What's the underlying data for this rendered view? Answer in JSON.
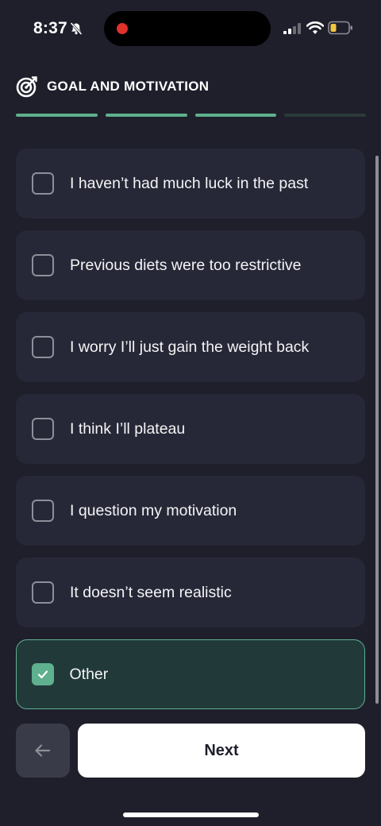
{
  "status_bar": {
    "time": "8:37",
    "icons": [
      "bell-slash-icon",
      "signal-icon",
      "wifi-icon",
      "battery-icon"
    ]
  },
  "header": {
    "icon": "target-icon",
    "title": "GOAL AND MOTIVATION"
  },
  "progress": {
    "total_steps": 4,
    "completed_steps": 3
  },
  "options": [
    {
      "label": "I haven’t had much luck in the past",
      "checked": false
    },
    {
      "label": "Previous diets were too restrictive",
      "checked": false
    },
    {
      "label": "I worry I’ll just gain the weight back",
      "checked": false
    },
    {
      "label": "I think I’ll plateau",
      "checked": false
    },
    {
      "label": "I question my motivation",
      "checked": false
    },
    {
      "label": "It doesn’t seem realistic",
      "checked": false
    },
    {
      "label": "Other",
      "checked": true
    }
  ],
  "footer": {
    "back_icon": "arrow-left-icon",
    "next_label": "Next"
  },
  "colors": {
    "background": "#1e1f2b",
    "card": "#272837",
    "accent": "#5fb08e",
    "selected_card": "#22393a"
  }
}
